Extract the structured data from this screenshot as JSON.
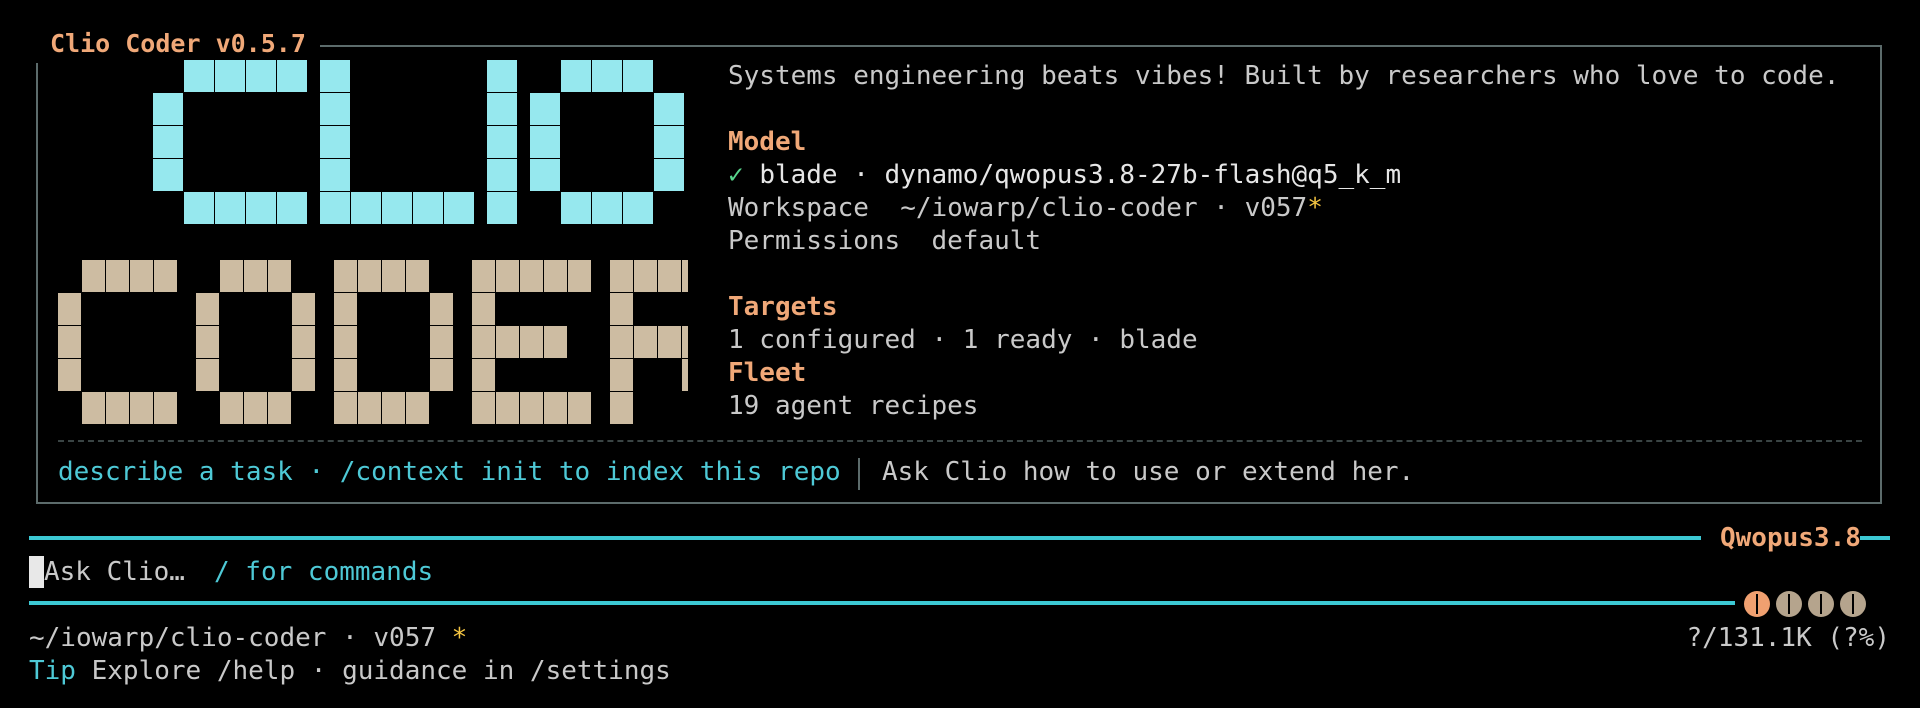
{
  "header": {
    "title": "Clio Coder v0.5.7",
    "tagline": "Systems engineering beats vibes! Built by researchers who love to code."
  },
  "logo": {
    "line1": "CLIO",
    "line2": "CODER",
    "line1_color": "#96e8ee",
    "line2_color": "#cdbca2"
  },
  "model": {
    "heading": "Model",
    "check": "✓",
    "value": "blade · dynamo/qwopus3.8-27b-flash@q5_k_m"
  },
  "workspace": {
    "label": "Workspace",
    "path": "~/iowarp/clio-coder · v057",
    "dirty": "*"
  },
  "permissions": {
    "label": "Permissions",
    "value": "default"
  },
  "targets": {
    "heading": "Targets",
    "value": "1 configured · 1 ready · blade"
  },
  "fleet": {
    "heading": "Fleet",
    "value": "19 agent recipes"
  },
  "hints": {
    "left": "describe a task · /context init to index this repo",
    "right": "Ask Clio how to use or extend her."
  },
  "input": {
    "model_label": "Qwopus3.8",
    "placeholder": "Ask Clio…",
    "commands_hint": "/ for commands"
  },
  "status": {
    "path": "~/iowarp/clio-coder",
    "branch": "v057",
    "dirty": "*",
    "context": "?/131.1K (?%)",
    "brain_icons": [
      "brain-active-icon",
      "brain-icon",
      "brain-icon",
      "brain-icon"
    ],
    "brain_active_color": "#f0a070",
    "brain_inactive_color": "#b5a48d"
  },
  "tip": {
    "label": "Tip",
    "text": "Explore /help · guidance in /settings"
  },
  "colors": {
    "accent": "#3cc9d4",
    "heading": "#f0a878",
    "border": "#5c6b6b"
  }
}
